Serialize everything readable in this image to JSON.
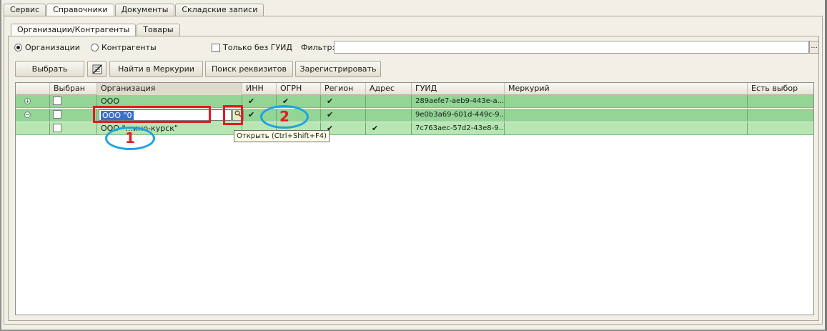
{
  "tabs_top": [
    "Сервис",
    "Справочники",
    "Документы",
    "Складские записи"
  ],
  "tabs_top_active": "Справочники",
  "tabs_sub": [
    "Организации/Контрагенты",
    "Товары"
  ],
  "tabs_sub_active": "Организации/Контрагенты",
  "options": {
    "radio_org": "Организации",
    "radio_contr": "Контрагенты",
    "only_without_guid": "Только без ГУИД",
    "filter_label": "Фильтр:",
    "filter_value": "",
    "filter_btn": "..."
  },
  "buttons": {
    "select": "Выбрать",
    "find_mercury": "Найти в Меркурии",
    "search_requisites": "Поиск реквизитов",
    "register": "Зарегистрировать"
  },
  "columns": [
    "Выбран",
    "Организация",
    "ИНН",
    "ОГРН",
    "Регион",
    "Адрес",
    "ГУИД",
    "Меркурий",
    "Есть выбор"
  ],
  "rows": [
    {
      "expander": "+",
      "org": "ООО",
      "inn": "✔",
      "ogrn": "✔",
      "region": "✔",
      "address": "",
      "guid": "289aefe7-aeb9-443e-a...",
      "mercury": "",
      "choice": ""
    },
    {
      "expander": "−",
      "org": "ООО \"0",
      "inn": "✔",
      "ogrn": "",
      "region": "✔",
      "address": "",
      "guid": "9e0b3a69-601d-449c-9...",
      "mercury": "",
      "choice": ""
    },
    {
      "expander": "",
      "org": "ООО \"...ино-курск\"",
      "inn": "",
      "ogrn": "",
      "region": "✔",
      "address": "✔",
      "guid": "7c763aec-57d2-43e8-9...",
      "mercury": "",
      "choice": ""
    }
  ],
  "editing_value": "ООО \"0",
  "open_button_icon": "magnifier-icon",
  "tooltip": "Открыть (Ctrl+Shift+F4)",
  "annotations": {
    "label1": "1",
    "label2": "2"
  },
  "colors": {
    "row_green": "#92d595",
    "row_light_green": "#b7e6b3",
    "annotation_red": "#e31b23",
    "annotation_blue": "#1da2e0"
  }
}
